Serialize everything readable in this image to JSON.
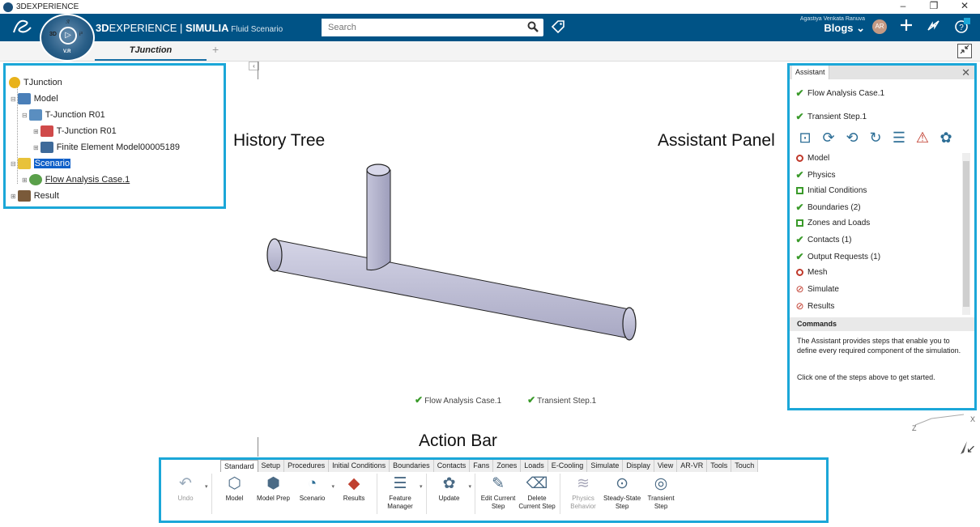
{
  "window": {
    "title": "3DEXPERIENCE",
    "minimize": "–",
    "restore": "❐",
    "close": "✕"
  },
  "topbar": {
    "ds_logo": "𝓓𝓢",
    "compass": {
      "label_3d": "3D",
      "label_i": "i³",
      "label_vr": "V.R",
      "label_top": "ℛ"
    },
    "brand_bold": "3D",
    "brand_main": "EXPERIENCE | ",
    "brand_app": "SIMULIA",
    "brand_sub": " Fluid Scenario",
    "search_placeholder": "Search",
    "user_name": "Agastiya Venkata Ranuva",
    "user_label": "Blogs ⌄",
    "avatar": "AR"
  },
  "tabs": {
    "active": "TJunction",
    "plus": "+"
  },
  "tree": {
    "root": "TJunction",
    "model": "Model",
    "tjr01a": "T-Junction R01",
    "tjr01b": "T-Junction R01",
    "fem": "Finite Element Model00005189",
    "scenario": "Scenario",
    "flow": "Flow Analysis Case.1",
    "result": "Result"
  },
  "labels": {
    "history": "History Tree",
    "assistant": "Assistant Panel",
    "action": "Action Bar"
  },
  "assistant": {
    "tab": "Assistant",
    "flow": "Flow Analysis Case.1",
    "transient": "Transient Step.1",
    "steps": {
      "model": "Model",
      "physics": "Physics",
      "initial": "Initial Conditions",
      "boundaries": "Boundaries (2)",
      "zones": "Zones and Loads",
      "contacts": "Contacts (1)",
      "output": "Output Requests (1)",
      "mesh": "Mesh",
      "simulate": "Simulate",
      "results": "Results"
    },
    "commands_title": "Commands",
    "commands_text": "The Assistant provides steps that enable you to define every required component of the simulation.",
    "commands_hint": "Click one of the steps above to get started."
  },
  "status": {
    "flow": "Flow Analysis Case.1",
    "transient": "Transient Step.1"
  },
  "axis": {
    "x": "X",
    "z": "Z"
  },
  "actionbar": {
    "tabs": [
      "Standard",
      "Setup",
      "Procedures",
      "Initial Conditions",
      "Boundaries",
      "Contacts",
      "Fans",
      "Zones",
      "Loads",
      "E-Cooling",
      "Simulate",
      "Display",
      "View",
      "AR-VR",
      "Tools",
      "Touch"
    ],
    "undo": "Undo",
    "model": "Model",
    "model_prep": "Model Prep",
    "scenario": "Scenario",
    "results": "Results",
    "feature_manager": "Feature Manager",
    "update": "Update",
    "edit_step": "Edit Current Step",
    "delete_step": "Delete Current Step",
    "physics_behavior": "Physics Behavior",
    "steady_state": "Steady-State Step",
    "transient_step": "Transient Step"
  },
  "colors": {
    "topbar": "#005386",
    "highlight": "#1ba7d8",
    "ok": "#3a9a2a",
    "error": "#c0392b"
  }
}
